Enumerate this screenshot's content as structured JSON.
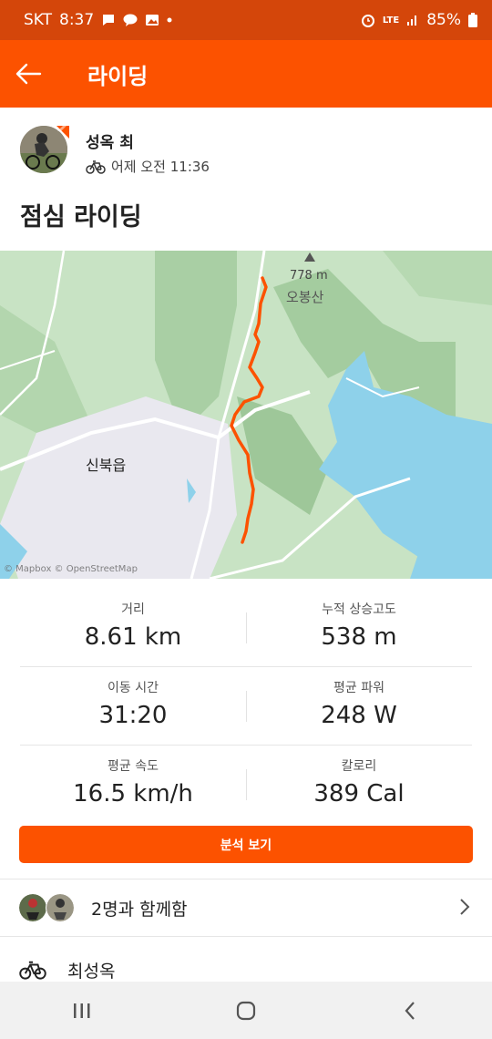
{
  "status_bar": {
    "carrier": "SKT",
    "time": "8:37",
    "network": "LTE",
    "battery": "85%"
  },
  "app_bar": {
    "title": "라이딩"
  },
  "athlete": {
    "name": "성옥 최",
    "date": "어제 오전 11:36"
  },
  "activity": {
    "title": "점심 라이딩"
  },
  "map": {
    "peak_elevation": "778 m",
    "peak_name": "오봉산",
    "town_name": "신북읍",
    "attribution": "© Mapbox © OpenStreetMap",
    "route_color": "#fc5200"
  },
  "stats": [
    {
      "label": "거리",
      "value": "8.61 km"
    },
    {
      "label": "누적 상승고도",
      "value": "538 m"
    },
    {
      "label": "이동 시간",
      "value": "31:20"
    },
    {
      "label": "평균 파워",
      "value": "248 W"
    },
    {
      "label": "평균 속도",
      "value": "16.5 km/h"
    },
    {
      "label": "칼로리",
      "value": "389 Cal"
    }
  ],
  "analysis_button": "분석 보기",
  "group": {
    "text": "2명과 함께함"
  },
  "athlete_row": {
    "name": "최성옥"
  },
  "theme": {
    "accent": "#fc5200",
    "status_bar": "#d4460a"
  }
}
